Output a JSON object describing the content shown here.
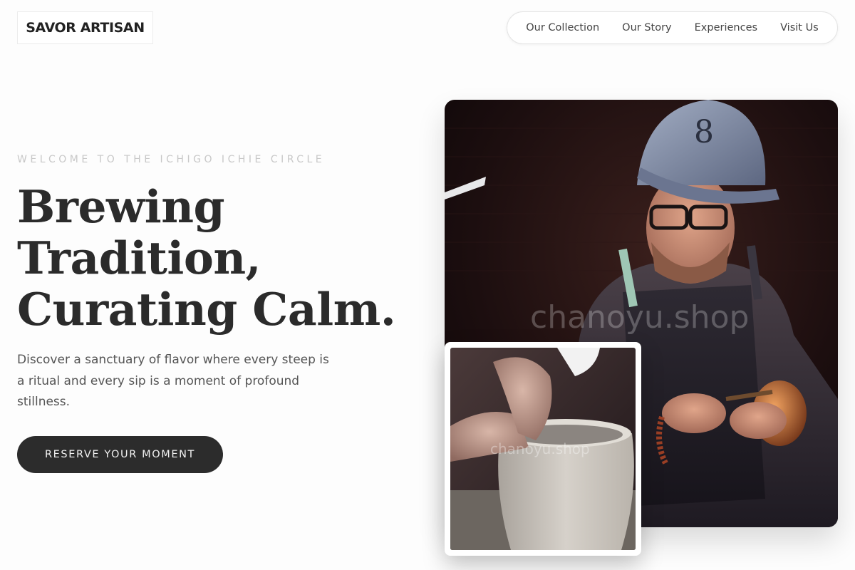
{
  "brand": {
    "name": "SAVOR ARTISAN"
  },
  "nav": {
    "items": [
      "Our Collection",
      "Our Story",
      "Experiences",
      "Visit Us"
    ]
  },
  "hero": {
    "eyebrow": "WELCOME TO THE ICHIGO ICHIE CIRCLE",
    "headline_lines": [
      "Brewing",
      "Tradition,",
      "Curating Calm."
    ],
    "description": "Discover a sanctuary of flavor where every steep is a ritual and every sip is a moment of profound stillness.",
    "cta_label": "RESERVE YOUR MOMENT"
  },
  "images": {
    "main_photo": {
      "subject": "potter-carving-vessel-photo",
      "watermark": "chanoyu.shop"
    },
    "inset_photo": {
      "subject": "hands-shaping-clay-on-wheel-photo",
      "watermark": "chanoyu.shop"
    }
  },
  "colors": {
    "background": "#fdfdfd",
    "text_dark": "#2b2b2b",
    "cta_bg": "#2c2c2c",
    "eyebrow": "#c8c8c8"
  }
}
